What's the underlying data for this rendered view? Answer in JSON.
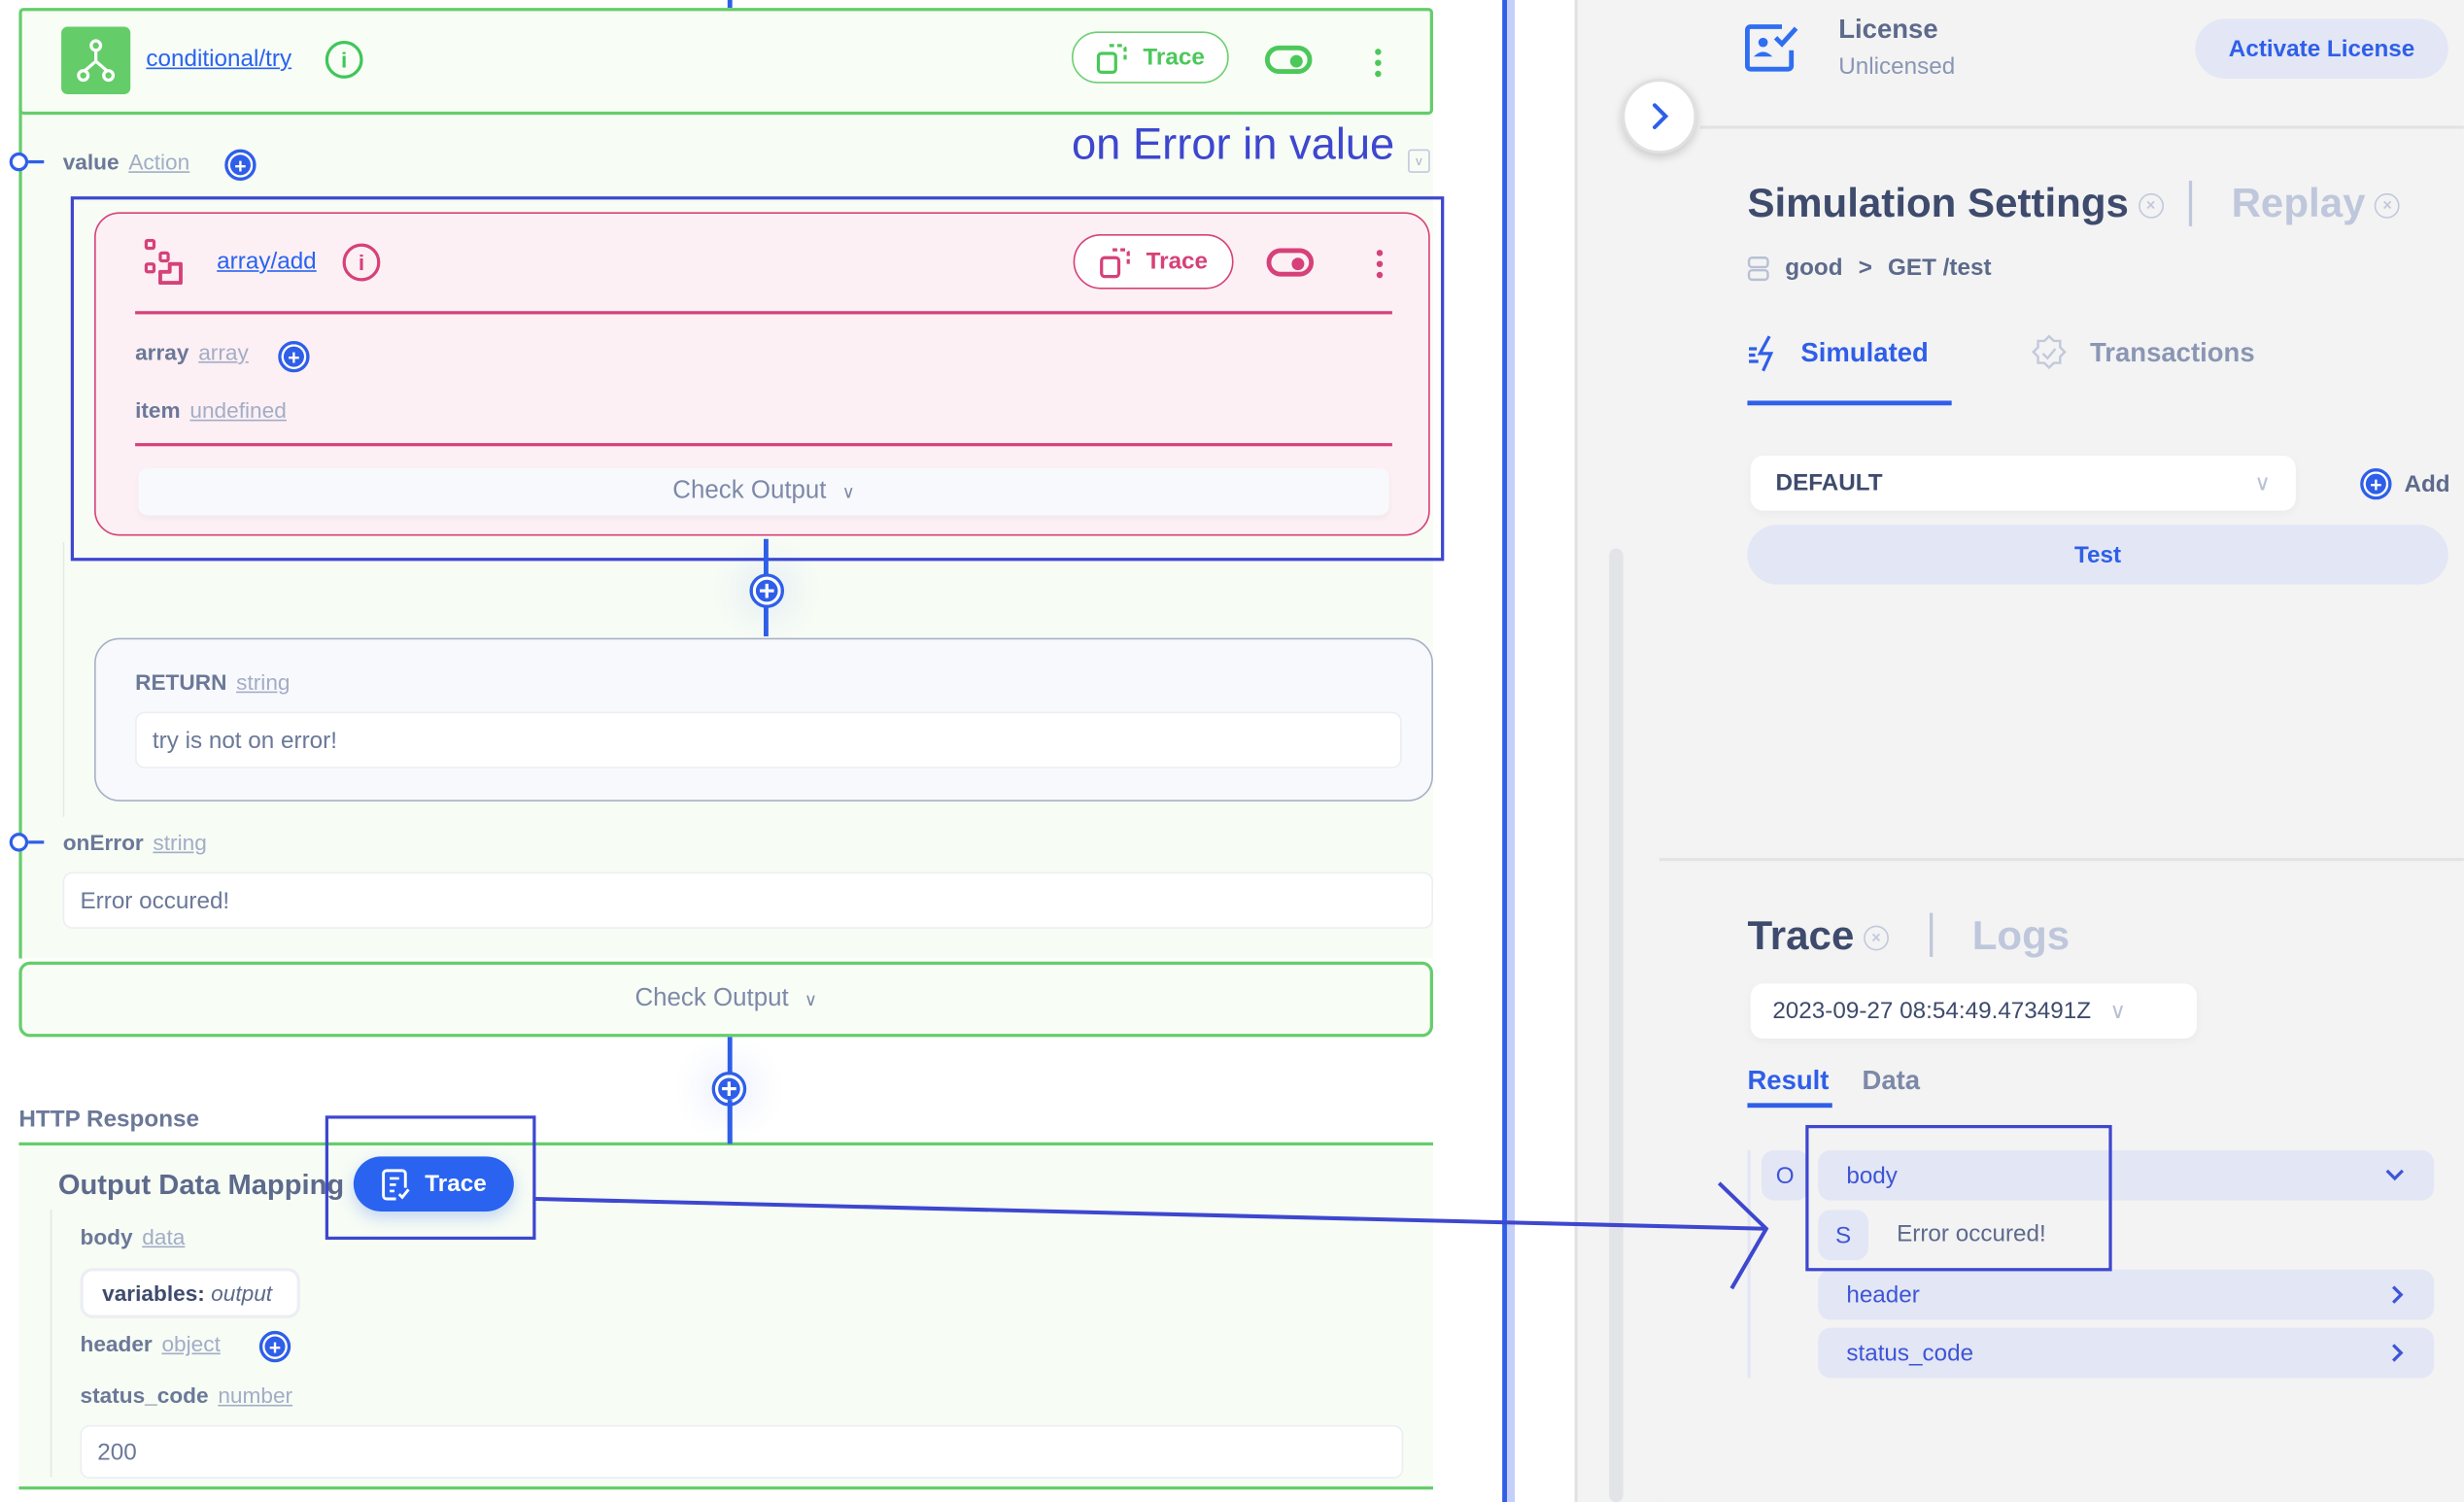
{
  "canvas": {
    "try_node": {
      "title": "conditional/try",
      "trace_label": "Trace",
      "value_label": "value",
      "value_type": "Action",
      "on_error_label": "onError",
      "on_error_type": "string",
      "on_error_value": "Error occured!",
      "check_output_label": "Check Output"
    },
    "array_node": {
      "title": "array/add",
      "trace_label": "Trace",
      "params": [
        {
          "name": "array",
          "type": "array"
        },
        {
          "name": "item",
          "type": "undefined"
        }
      ],
      "check_output_label": "Check Output"
    },
    "return_node": {
      "label": "RETURN",
      "type": "string",
      "value": "try is not on error!"
    },
    "http_response": {
      "section_label": "HTTP Response",
      "mapping_title": "Output Data Mapping",
      "trace_label": "Trace",
      "fields": [
        {
          "name": "body",
          "type": "data"
        },
        {
          "name": "header",
          "type": "object"
        },
        {
          "name": "status_code",
          "type": "number"
        }
      ],
      "body_chip_key": "variables:",
      "body_chip_value": "output",
      "status_code_value": "200"
    },
    "annotation_text": "on Error in value"
  },
  "right": {
    "license": {
      "title": "License",
      "status": "Unlicensed",
      "activate_label": "Activate License"
    },
    "simulation": {
      "title": "Simulation Settings",
      "replay_label": "Replay",
      "breadcrumb_project": "good",
      "breadcrumb_sep": ">",
      "breadcrumb_endpoint": "GET /test",
      "tabs": [
        {
          "label": "Simulated",
          "active": true
        },
        {
          "label": "Transactions",
          "active": false
        }
      ],
      "scenario_selected": "DEFAULT",
      "add_label": "Add",
      "test_label": "Test"
    },
    "trace": {
      "title": "Trace",
      "logs_label": "Logs",
      "timestamp_selected": "2023-09-27 08:54:49.473491Z",
      "tabs": [
        {
          "label": "Result",
          "active": true
        },
        {
          "label": "Data",
          "active": false
        }
      ],
      "tree": {
        "root_badge": "O",
        "items": [
          {
            "key": "body",
            "expanded": true,
            "child_badge": "S",
            "child_value": "Error occured!"
          },
          {
            "key": "header",
            "expanded": false
          },
          {
            "key": "status_code",
            "expanded": false
          }
        ]
      }
    }
  },
  "colors": {
    "accent_blue": "#2f5fe8",
    "try_green": "#65cd6b",
    "array_pink": "#d64179",
    "annotation": "#3d47cf"
  }
}
